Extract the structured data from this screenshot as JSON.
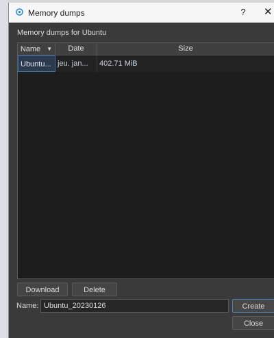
{
  "window": {
    "title": "Memory dumps",
    "help_label": "?",
    "close_label": "✕"
  },
  "subtitle": "Memory dumps for Ubuntu",
  "table": {
    "headers": {
      "name": "Name",
      "date": "Date",
      "size": "Size"
    },
    "sort": {
      "column": "name",
      "direction": "descending"
    },
    "rows": [
      {
        "name": "Ubuntu...",
        "date": "jeu. jan...",
        "size": "402.71 MiB"
      }
    ]
  },
  "buttons": {
    "download": "Download",
    "delete": "Delete",
    "create": "Create",
    "close": "Close"
  },
  "name_field": {
    "label": "Name:",
    "value": "Ubuntu_20230126"
  },
  "colors": {
    "accent": "#3a70b0",
    "background": "#3a3a3a",
    "table_bg": "#1d1d1d"
  }
}
